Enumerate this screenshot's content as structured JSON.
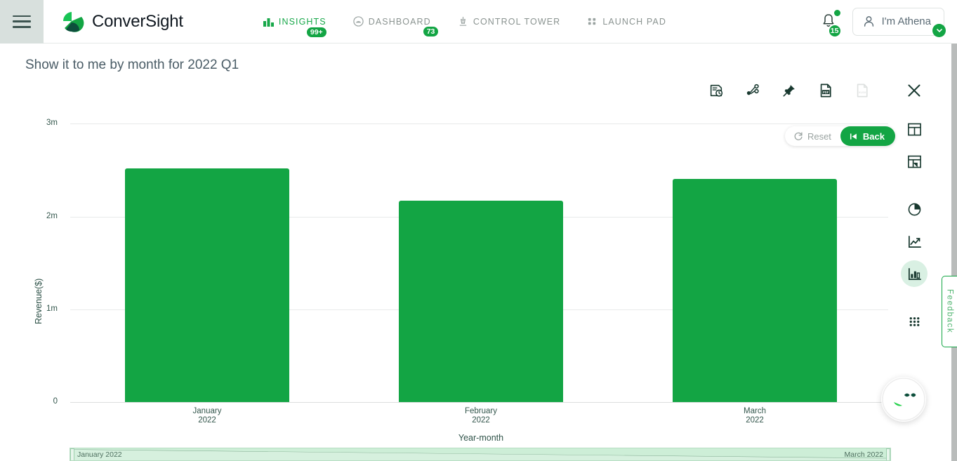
{
  "header": {
    "menu_icon": "hamburger-icon",
    "brand": "ConverSight",
    "nav": [
      {
        "label": "INSIGHTS",
        "icon": "bar-chart-icon",
        "badge": "99+",
        "active": true
      },
      {
        "label": "DASHBOARD",
        "icon": "gauge-icon",
        "badge": "73",
        "active": false
      },
      {
        "label": "CONTROL TOWER",
        "icon": "control-tower-icon",
        "badge": "",
        "active": false
      },
      {
        "label": "LAUNCH PAD",
        "icon": "grid-dots-icon",
        "badge": "",
        "active": false
      }
    ],
    "notifications": {
      "icon": "bell-icon",
      "badge": "15",
      "has_dot": true
    },
    "user": {
      "icon": "user-icon",
      "name": "I'm Athena",
      "caret": "chevron-down-icon"
    }
  },
  "page_title": "Show it to me by month for 2022 Q1",
  "toolbar": [
    {
      "name": "history-icon",
      "label": "History",
      "disabled": false
    },
    {
      "name": "share-icon",
      "label": "Share",
      "disabled": false
    },
    {
      "name": "pin-icon",
      "label": "Pin",
      "disabled": false
    },
    {
      "name": "pdf-export-icon",
      "label": "PDF",
      "disabled": false
    },
    {
      "name": "xlsx-export-icon",
      "label": "XLSX",
      "disabled": true
    },
    {
      "name": "close-icon",
      "label": "Close",
      "disabled": false
    }
  ],
  "view_rail": [
    {
      "name": "table-view-icon",
      "label": "Table",
      "active": false
    },
    {
      "name": "pivot-view-icon",
      "label": "Pivot",
      "active": false
    },
    {
      "name": "pie-chart-icon",
      "label": "Pie chart",
      "active": false
    },
    {
      "name": "line-chart-icon",
      "label": "Line chart",
      "active": false
    },
    {
      "name": "bar-chart-icon",
      "label": "Bar chart",
      "active": true
    },
    {
      "name": "more-options-icon",
      "label": "More",
      "active": false
    }
  ],
  "chart_actions": {
    "reset_label": "Reset",
    "reset_icon": "refresh-icon",
    "back_label": "Back",
    "back_icon": "skip-back-icon"
  },
  "range_slider": {
    "start_label": "January 2022",
    "end_label": "March 2022"
  },
  "feedback_tab": {
    "label": "Feedback"
  },
  "chat": {
    "name": "athena-assistant-avatar"
  },
  "colors": {
    "brand_green": "#13a544",
    "bar_green": "#13a544",
    "dark_teal": "#0d4f3c",
    "axis_text": "#33564c",
    "title_text": "#4a5c66"
  },
  "chart_data": {
    "type": "bar",
    "title": "",
    "xlabel": "Year-month",
    "ylabel": "Revenue($)",
    "categories": [
      "January\n2022",
      "February\n2022",
      "March\n2022"
    ],
    "categories_display": [
      {
        "line1": "January",
        "line2": "2022"
      },
      {
        "line1": "February",
        "line2": "2022"
      },
      {
        "line1": "March",
        "line2": "2022"
      }
    ],
    "values": [
      2520000,
      2170000,
      2400000
    ],
    "ylim": [
      0,
      3000000
    ],
    "ytick_values": [
      0,
      1000000,
      2000000,
      3000000
    ],
    "ytick_labels": [
      "0",
      "1m",
      "2m",
      "3m"
    ],
    "grid": true,
    "legend": false,
    "bar_color": "#13a544"
  }
}
